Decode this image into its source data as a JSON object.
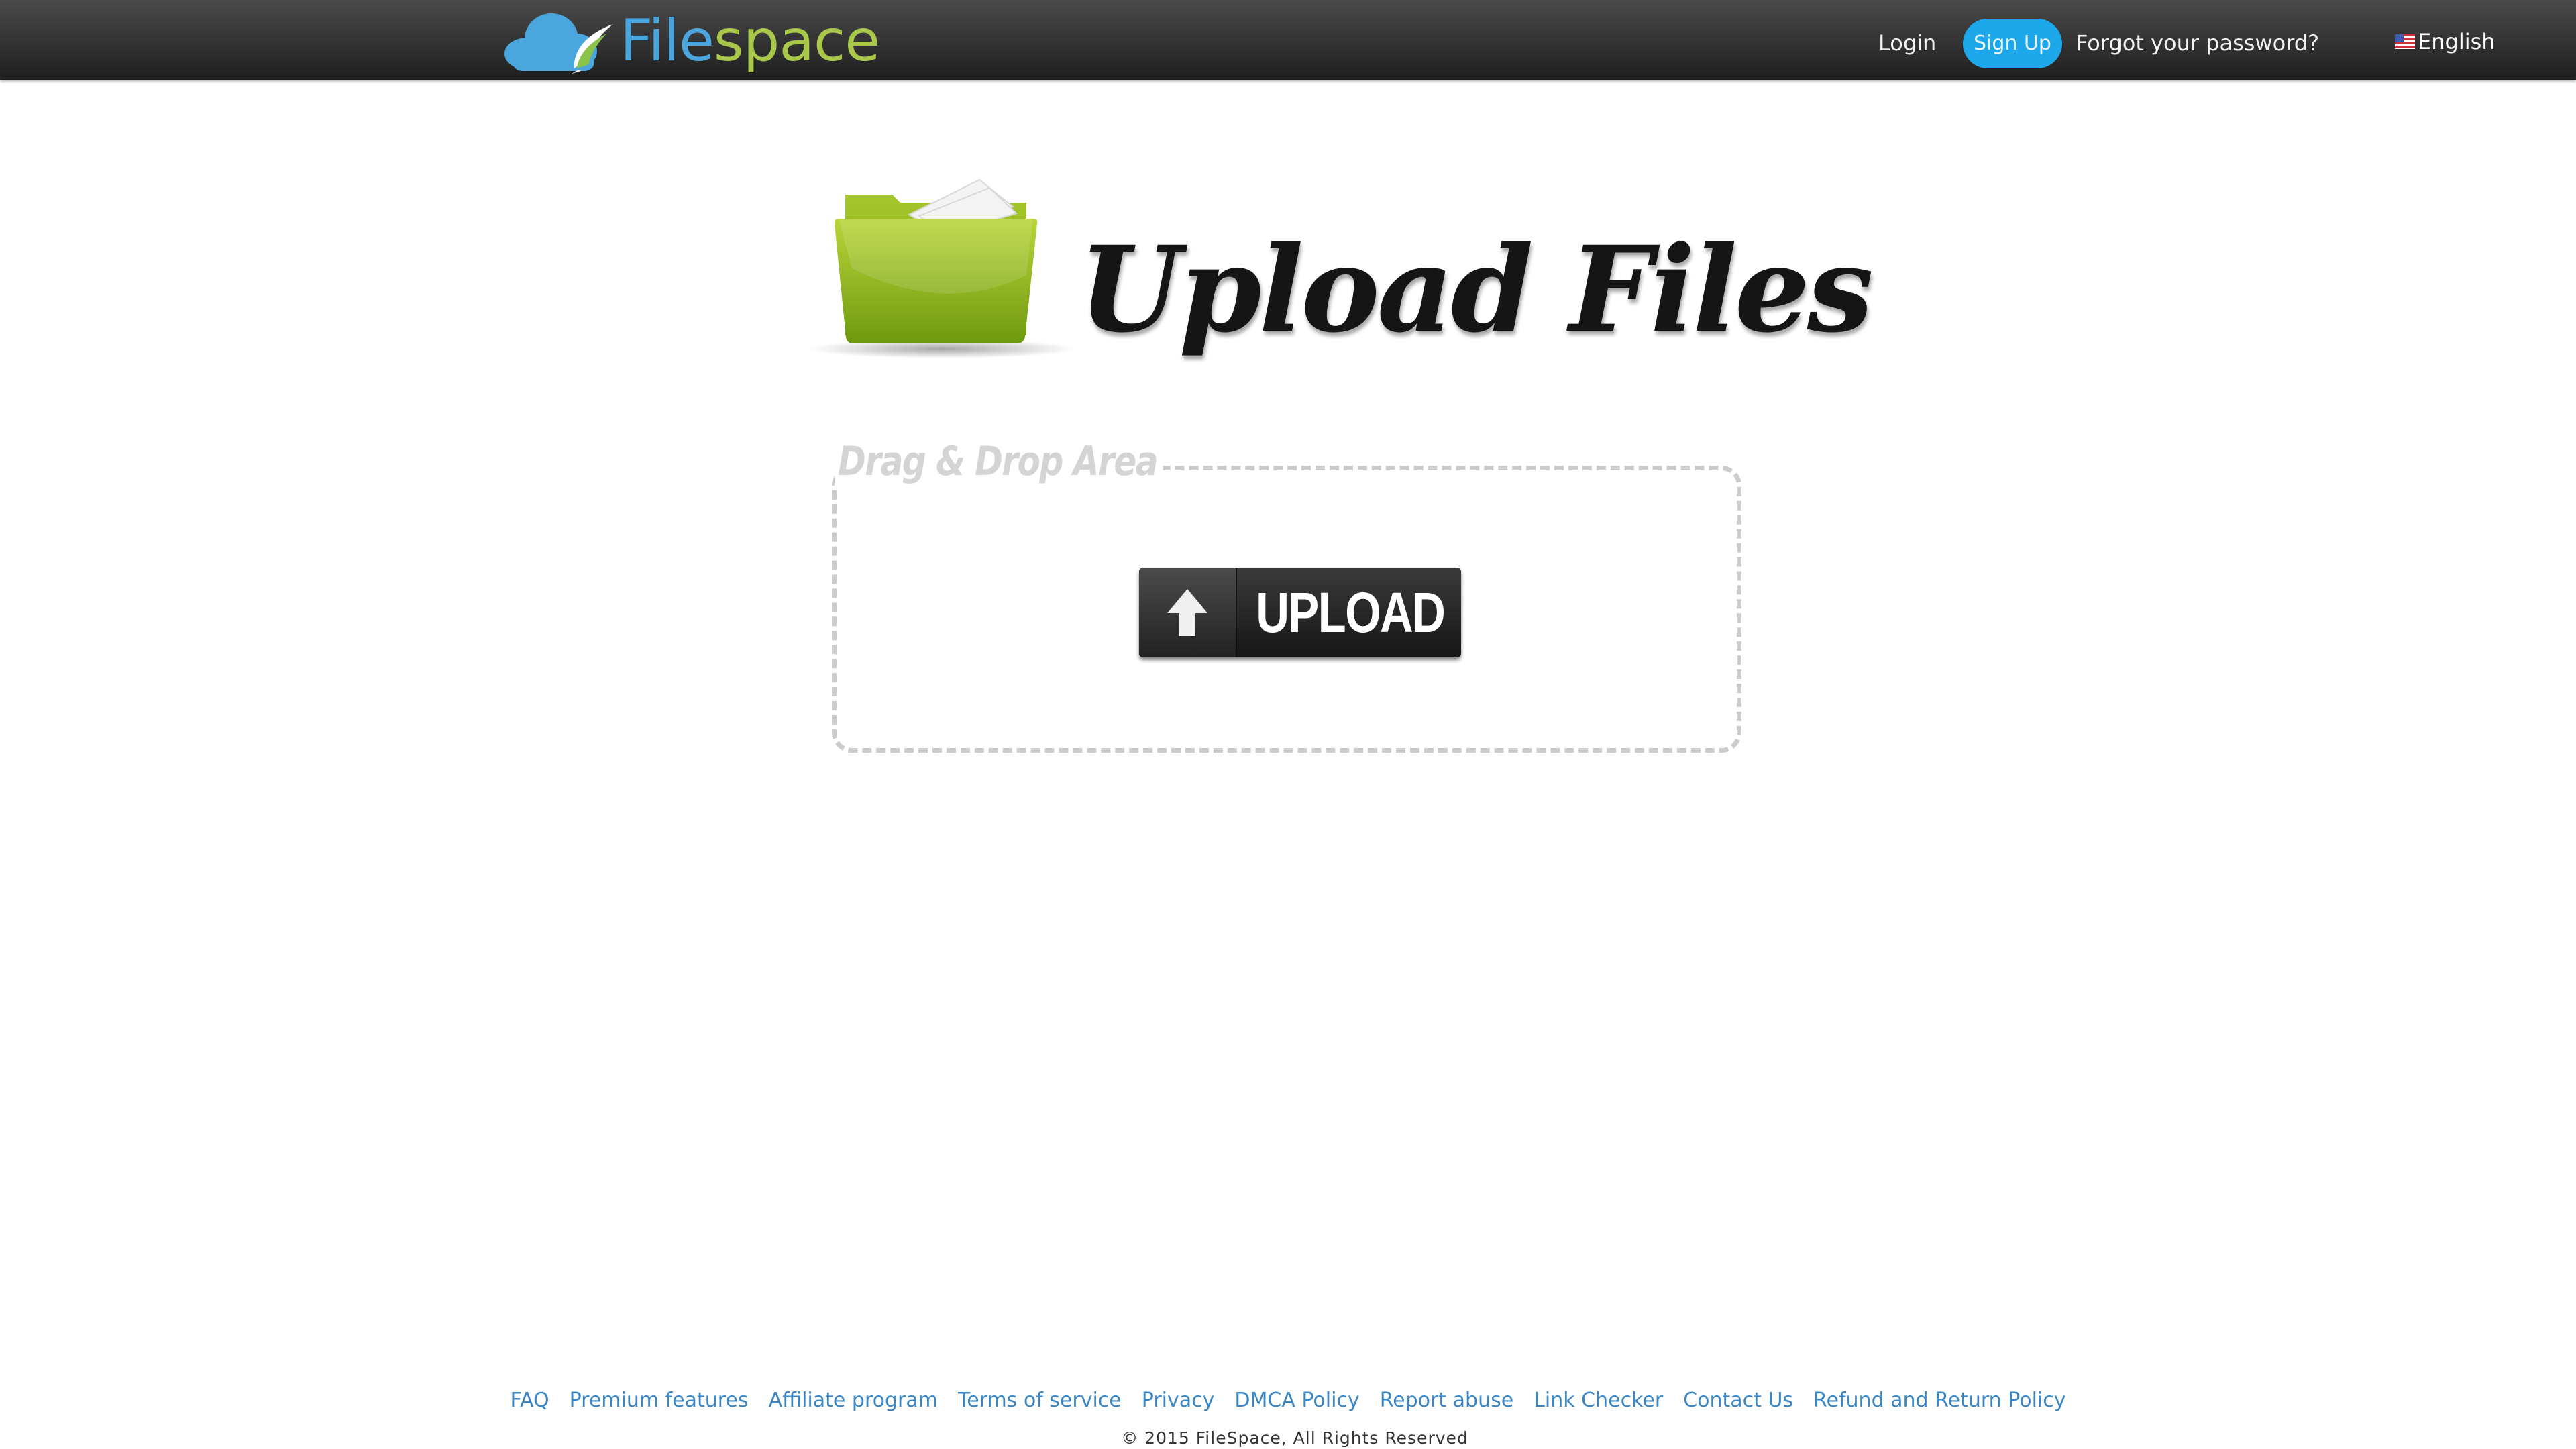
{
  "header": {
    "logo_part1": "File",
    "logo_part2": "space",
    "nav": {
      "login": "Login",
      "signup": "Sign Up",
      "forgot": "Forgot your password?",
      "language": "English"
    }
  },
  "main": {
    "hero_title": "Upload Files",
    "drop_area_label": "Drag & Drop Area",
    "upload_button": "UPLOAD"
  },
  "footer": {
    "links": [
      "FAQ",
      "Premium features",
      "Affiliate program",
      "Terms of service",
      "Privacy",
      "DMCA Policy",
      "Report abuse",
      "Link Checker",
      "Contact Us",
      "Refund and Return Policy"
    ],
    "copyright": "© 2015 FileSpace, All Rights Reserved"
  },
  "colors": {
    "topbar": "#2e2e2e",
    "signup": "#1ca8ea",
    "logo_file": "#4aa6dc",
    "logo_space": "#a9c74a",
    "link": "#3a86c4",
    "folder": "#8fba1e"
  }
}
